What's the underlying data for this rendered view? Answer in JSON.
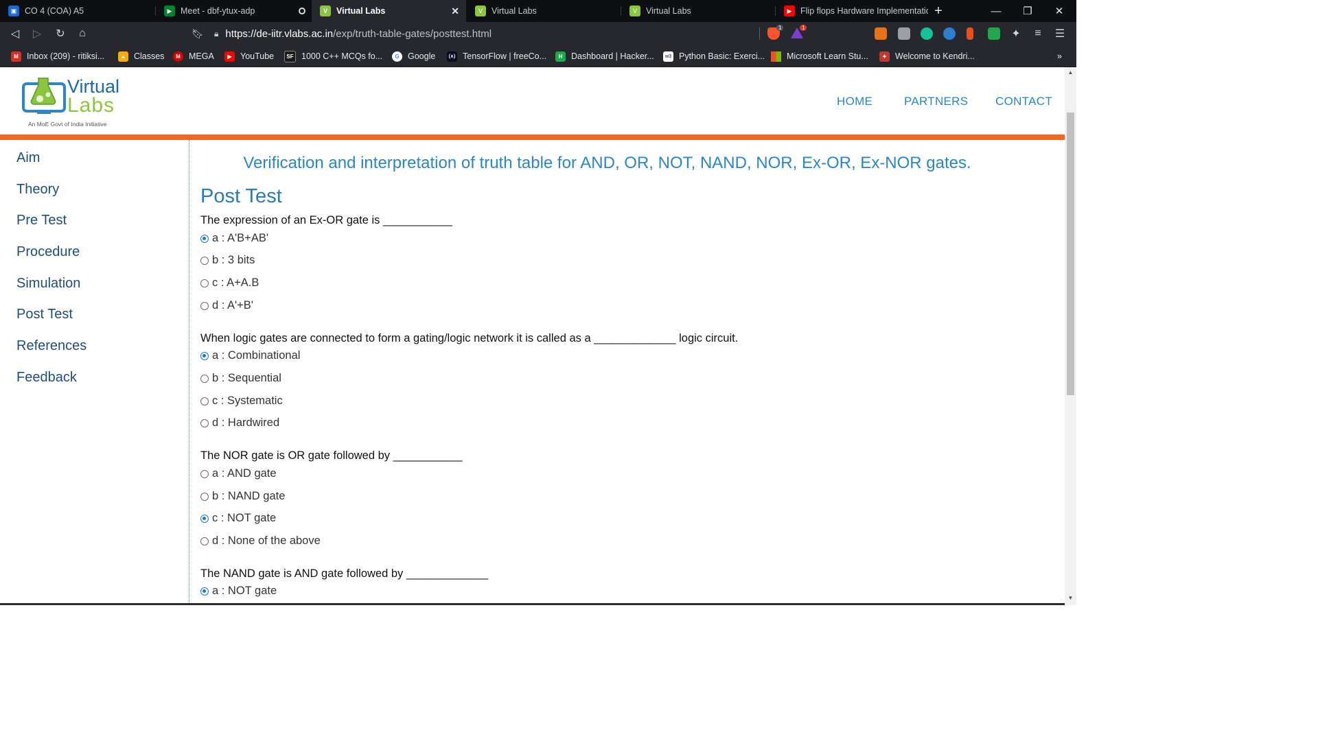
{
  "browser": {
    "tabs": [
      {
        "title": "CO 4 (COA) A5",
        "icon": "classroom-icon",
        "color": "#1e66d0"
      },
      {
        "title": "Meet - dbf-ytux-adp",
        "icon": "meet-icon",
        "color": "#00832d"
      },
      {
        "title": "Virtual Labs",
        "icon": "vlabs-icon",
        "color": "#8cc63f",
        "active": true
      },
      {
        "title": "Virtual Labs",
        "icon": "vlabs-icon",
        "color": "#8cc63f"
      },
      {
        "title": "Virtual Labs",
        "icon": "vlabs-icon",
        "color": "#8cc63f"
      },
      {
        "title": "Flip flops Hardware Implementatio",
        "icon": "youtube-icon",
        "color": "#ff0000"
      }
    ],
    "url_host": "https://de-iitr.vlabs.ac.in",
    "url_path": "/exp/truth-table-gates/posttest.html",
    "brave_badge": "1",
    "rewards_badge": "1",
    "bookmarks": [
      {
        "label": "Inbox (209) - ritiksi...",
        "icon": "gmail-icon",
        "color": "#d93025",
        "glyph": "M"
      },
      {
        "label": "Classes",
        "icon": "classroom-icon",
        "color": "#f9ab00",
        "glyph": "▲"
      },
      {
        "label": "MEGA",
        "icon": "mega-icon",
        "color": "#d90007",
        "glyph": "M"
      },
      {
        "label": "YouTube",
        "icon": "youtube-icon",
        "color": "#ff0000",
        "glyph": "▶"
      },
      {
        "label": "1000 C++ MCQs fo...",
        "icon": "sanfoundry-icon",
        "color": "#1a1a1a",
        "glyph": "SF"
      },
      {
        "label": "Google",
        "icon": "google-icon",
        "color": "#ffffff",
        "glyph": "G"
      },
      {
        "label": "TensorFlow | freeCo...",
        "icon": "freecodecamp-icon",
        "color": "#0a0a23",
        "glyph": "(∧)"
      },
      {
        "label": "Dashboard | Hacker...",
        "icon": "hackerrank-icon",
        "color": "#1ba94c",
        "glyph": "H"
      },
      {
        "label": "Python Basic: Exerci...",
        "icon": "w3resource-icon",
        "color": "#ffffff",
        "glyph": "w3"
      },
      {
        "label": "Microsoft Learn Stu...",
        "icon": "microsoft-icon",
        "color": "#f25022",
        "glyph": ""
      },
      {
        "label": "Welcome to Kendri...",
        "icon": "kv-icon",
        "color": "#c0392b",
        "glyph": "✦"
      }
    ],
    "more_bookmarks": "»"
  },
  "site": {
    "logo_line1": "Virtual",
    "logo_line2": "Labs",
    "logo_tagline": "An MoE Govt of India Initiative",
    "nav": [
      "HOME",
      "PARTNERS",
      "CONTACT"
    ],
    "accent_color": "#f26722"
  },
  "sidebar": {
    "items": [
      "Aim",
      "Theory",
      "Pre Test",
      "Procedure",
      "Simulation",
      "Post Test",
      "References",
      "Feedback"
    ]
  },
  "content": {
    "experiment_title": "Verification and interpretation of truth table for AND, OR, NOT, NAND, NOR, Ex-OR, Ex-NOR gates.",
    "section_title": "Post Test",
    "questions": [
      {
        "text": "The expression of an Ex-OR gate is ___________",
        "options": [
          {
            "label": "a : A'B+AB'",
            "checked": true
          },
          {
            "label": "b : 3 bits",
            "checked": false
          },
          {
            "label": "c : A+A.B",
            "checked": false
          },
          {
            "label": "d : A'+B'",
            "checked": false
          }
        ]
      },
      {
        "text": "When logic gates are connected to form a gating/logic network it is called as a _____________ logic circuit.",
        "options": [
          {
            "label": "a : Combinational",
            "checked": true
          },
          {
            "label": "b : Sequential",
            "checked": false
          },
          {
            "label": "c : Systematic",
            "checked": false
          },
          {
            "label": "d : Hardwired",
            "checked": false
          }
        ]
      },
      {
        "text": "The NOR gate is OR gate followed by ___________",
        "options": [
          {
            "label": "a : AND gate",
            "checked": false
          },
          {
            "label": "b : NAND gate",
            "checked": false
          },
          {
            "label": "c : NOT gate",
            "checked": true
          },
          {
            "label": "d : None of the above",
            "checked": false
          }
        ]
      },
      {
        "text": "The NAND gate is AND gate followed by _____________",
        "options": [
          {
            "label": "a : NOT gate",
            "checked": true
          }
        ]
      }
    ]
  }
}
